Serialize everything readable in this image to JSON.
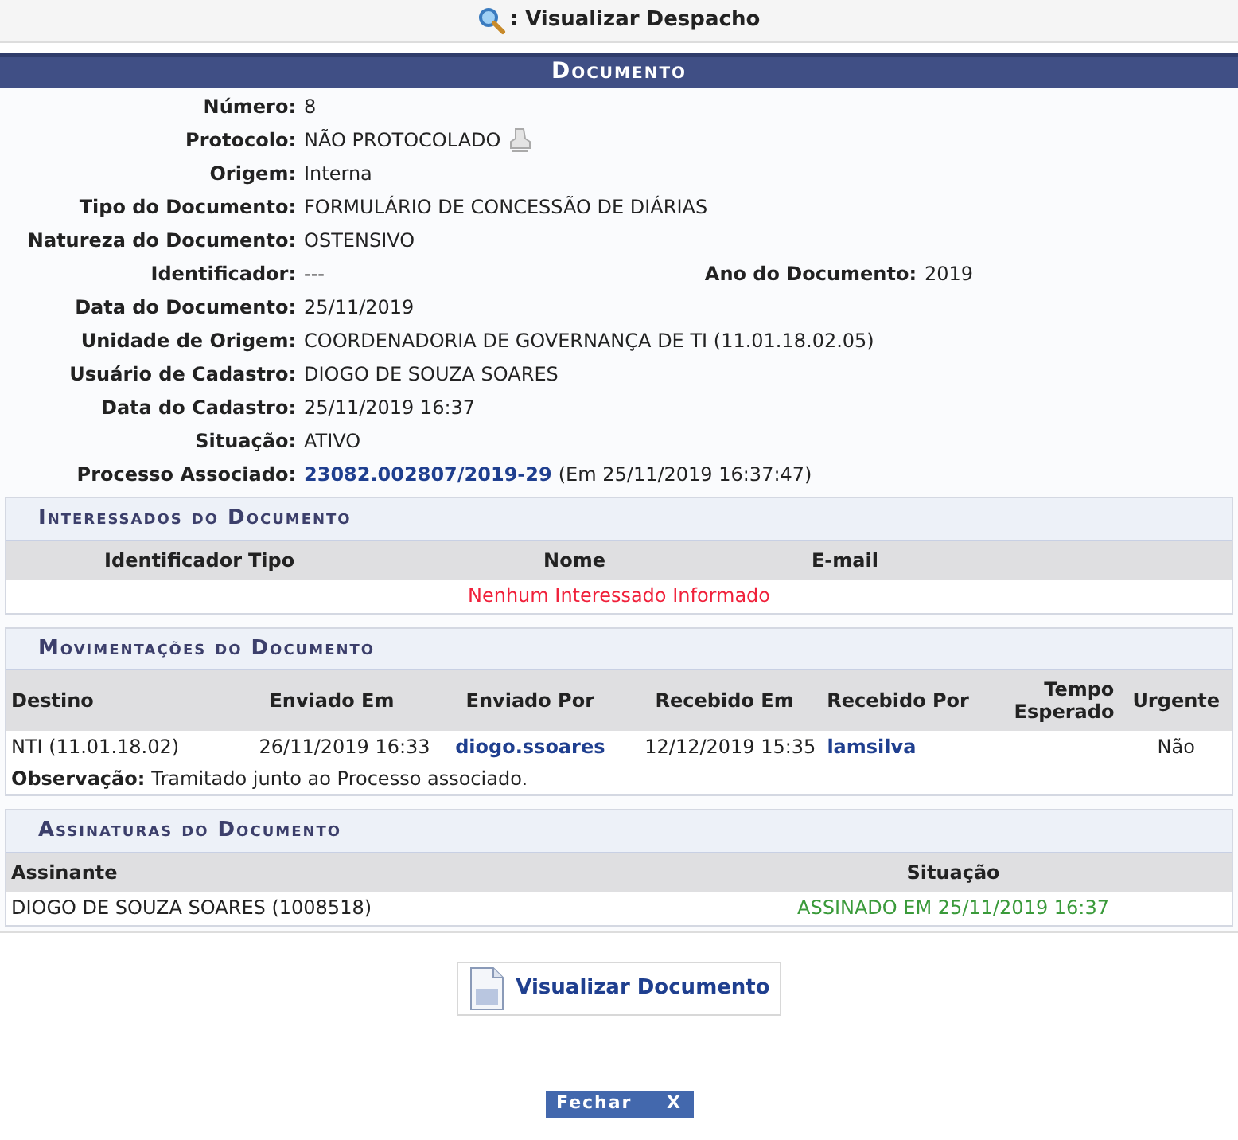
{
  "page_title": ": Visualizar Despacho",
  "document": {
    "title": "Documento",
    "fields": [
      {
        "kind": "text",
        "label": "Número:",
        "value": "8"
      },
      {
        "kind": "protocol",
        "label": "Protocolo:",
        "value": "NÃO PROTOCOLADO"
      },
      {
        "kind": "text",
        "label": "Origem:",
        "value": "Interna"
      },
      {
        "kind": "text",
        "label": "Tipo do Documento:",
        "value": "FORMULÁRIO DE CONCESSÃO DE DIÁRIAS"
      },
      {
        "kind": "text",
        "label": "Natureza do Documento:",
        "value": "OSTENSIVO"
      },
      {
        "kind": "pair",
        "items": [
          {
            "label": "Identificador:",
            "value": "---"
          },
          {
            "label": "Ano do Documento:",
            "value": "2019"
          }
        ]
      },
      {
        "kind": "text",
        "label": "Data do Documento:",
        "value": "25/11/2019"
      },
      {
        "kind": "text",
        "label": "Unidade de Origem:",
        "value": "COORDENADORIA DE GOVERNANÇA DE TI (11.01.18.02.05)"
      },
      {
        "kind": "text",
        "label": "Usuário de Cadastro:",
        "value": "DIOGO DE SOUZA SOARES"
      },
      {
        "kind": "text",
        "label": "Data do Cadastro:",
        "value": "25/11/2019 16:37"
      },
      {
        "kind": "text",
        "label": "Situação:",
        "value": "ATIVO"
      },
      {
        "kind": "link",
        "label": "Processo Associado:",
        "link": "23082.002807/2019-29",
        "value": "(Em 25/11/2019 16:37:47)"
      }
    ]
  },
  "interessados": {
    "title": "Interessados do Documento",
    "columns": [
      "Identificador",
      "Tipo",
      "Nome",
      "E-mail"
    ],
    "empty": "Nenhum Interessado Informado"
  },
  "movimentacoes": {
    "title": "Movimentações do Documento",
    "columns": [
      "Destino",
      "Enviado Em",
      "Enviado Por",
      "Recebido Em",
      "Recebido Por",
      "Tempo Esperado",
      "Urgente"
    ],
    "rows": [
      {
        "destino": "NTI (11.01.18.02)",
        "enviado_em": "26/11/2019 16:33",
        "enviado_por": "diogo.ssoares",
        "recebido_em": "12/12/2019 15:35",
        "recebido_por": "lamsilva",
        "urgente": "Não",
        "obs_label": "Observação:",
        "obs": "Tramitado junto ao Processo associado."
      }
    ]
  },
  "assinaturas": {
    "title": "Assinaturas do Documento",
    "columns": [
      "Assinante",
      "Situação"
    ],
    "rows": [
      {
        "assinante": "DIOGO DE SOUZA SOARES (1008518)",
        "situacao": "ASSINADO EM 25/11/2019 16:37"
      }
    ]
  },
  "view_button": "Visualizar Documento",
  "close_button": {
    "label": "Fechar",
    "icon": "X"
  }
}
